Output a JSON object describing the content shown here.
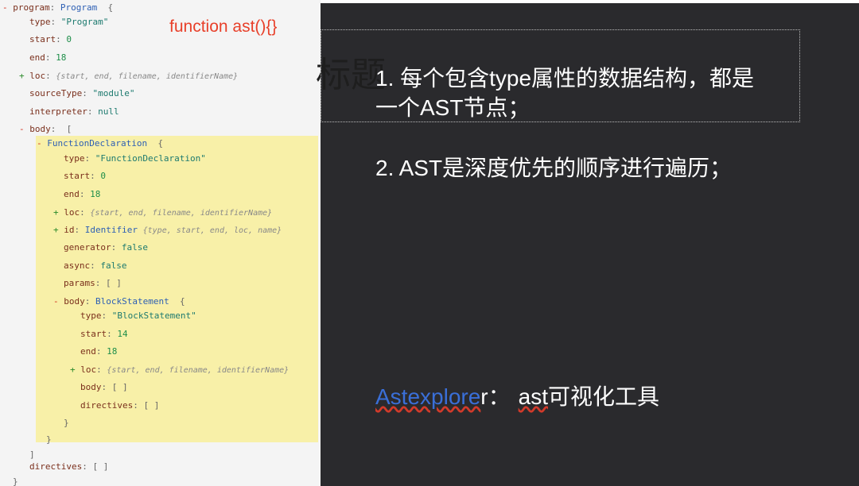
{
  "ast_tree": {
    "lines": [
      {
        "parts": [
          [
            "- ",
            "pm"
          ],
          [
            "program",
            "key"
          ],
          [
            ": ",
            "br"
          ],
          [
            "Program",
            "cname"
          ],
          [
            "  {",
            "br"
          ]
        ]
      },
      {
        "parts": [
          [
            "type",
            "key"
          ],
          [
            ": ",
            "br"
          ],
          [
            "\"Program\"",
            "str"
          ]
        ]
      },
      {
        "parts": [
          [
            "start",
            "key"
          ],
          [
            ": ",
            "br"
          ],
          [
            "0",
            "num"
          ]
        ]
      },
      {
        "parts": [
          [
            "end",
            "key"
          ],
          [
            ": ",
            "br"
          ],
          [
            "18",
            "num"
          ]
        ]
      },
      {
        "parts": [
          [
            "+ ",
            "pp"
          ],
          [
            "loc",
            "key"
          ],
          [
            ": ",
            "br"
          ],
          [
            "{start, end, filename, identifierName}",
            "ital"
          ]
        ]
      },
      {
        "parts": [
          [
            "sourceType",
            "key"
          ],
          [
            ": ",
            "br"
          ],
          [
            "\"module\"",
            "str"
          ]
        ]
      },
      {
        "parts": [
          [
            "interpreter",
            "key"
          ],
          [
            ": ",
            "br"
          ],
          [
            "null",
            "kw"
          ]
        ]
      },
      {
        "parts": [
          [
            "- ",
            "pm"
          ],
          [
            "body",
            "key"
          ],
          [
            ":  [",
            "br"
          ]
        ]
      },
      {
        "parts": [
          [
            "- ",
            "pm"
          ],
          [
            "FunctionDeclaration",
            "cname"
          ],
          [
            "  {",
            "br"
          ]
        ]
      },
      {
        "parts": [
          [
            "type",
            "key"
          ],
          [
            ": ",
            "br"
          ],
          [
            "\"FunctionDeclaration\"",
            "str"
          ]
        ]
      },
      {
        "parts": [
          [
            "start",
            "key"
          ],
          [
            ": ",
            "br"
          ],
          [
            "0",
            "num"
          ]
        ]
      },
      {
        "parts": [
          [
            "end",
            "key"
          ],
          [
            ": ",
            "br"
          ],
          [
            "18",
            "num"
          ]
        ]
      },
      {
        "parts": [
          [
            "+ ",
            "pp"
          ],
          [
            "loc",
            "key"
          ],
          [
            ": ",
            "br"
          ],
          [
            "{start, end, filename, identifierName}",
            "ital"
          ]
        ]
      },
      {
        "parts": [
          [
            "+ ",
            "pp"
          ],
          [
            "id",
            "key"
          ],
          [
            ": ",
            "br"
          ],
          [
            "Identifier",
            "cname"
          ],
          [
            " ",
            "br"
          ],
          [
            "{type, start, end, loc, name}",
            "ital"
          ]
        ]
      },
      {
        "parts": [
          [
            "generator",
            "key"
          ],
          [
            ": ",
            "br"
          ],
          [
            "false",
            "kw"
          ]
        ]
      },
      {
        "parts": [
          [
            "async",
            "key"
          ],
          [
            ": ",
            "br"
          ],
          [
            "false",
            "kw"
          ]
        ]
      },
      {
        "parts": [
          [
            "params",
            "key"
          ],
          [
            ": ",
            "br"
          ],
          [
            "[ ]",
            "br"
          ]
        ]
      },
      {
        "parts": [
          [
            "- ",
            "pm"
          ],
          [
            "body",
            "key"
          ],
          [
            ": ",
            "br"
          ],
          [
            "BlockStatement",
            "cname"
          ],
          [
            "  {",
            "br"
          ]
        ]
      },
      {
        "parts": [
          [
            "type",
            "key"
          ],
          [
            ": ",
            "br"
          ],
          [
            "\"BlockStatement\"",
            "str"
          ]
        ]
      },
      {
        "parts": [
          [
            "start",
            "key"
          ],
          [
            ": ",
            "br"
          ],
          [
            "14",
            "num"
          ]
        ]
      },
      {
        "parts": [
          [
            "end",
            "key"
          ],
          [
            ": ",
            "br"
          ],
          [
            "18",
            "num"
          ]
        ]
      },
      {
        "parts": [
          [
            "+ ",
            "pp"
          ],
          [
            "loc",
            "key"
          ],
          [
            ": ",
            "br"
          ],
          [
            "{start, end, filename, identifierName}",
            "ital"
          ]
        ]
      },
      {
        "parts": [
          [
            "body",
            "key"
          ],
          [
            ": ",
            "br"
          ],
          [
            "[ ]",
            "br"
          ]
        ]
      },
      {
        "parts": [
          [
            "directives",
            "key"
          ],
          [
            ": ",
            "br"
          ],
          [
            "[ ]",
            "br"
          ]
        ]
      },
      {
        "parts": [
          [
            "}",
            "br"
          ]
        ]
      },
      {
        "parts": [
          [
            "}",
            "br"
          ]
        ]
      },
      {
        "parts": [
          [
            "]",
            "br"
          ]
        ]
      },
      {
        "parts": [
          [
            "directives",
            "key"
          ],
          [
            ": ",
            "br"
          ],
          [
            "[ ]",
            "br"
          ]
        ]
      },
      {
        "parts": [
          [
            "}",
            "br"
          ]
        ]
      }
    ]
  },
  "annotation": {
    "code": "function ast(){}"
  },
  "slide": {
    "ghost_title": "标题",
    "point1_line1": "1. 每个包含type属性的数据结构，都是",
    "point1_line2": "一个AST节点；",
    "point2": "2. AST是深度优先的顺序进行遍历；",
    "tool": {
      "link_text": "Astexplore",
      "tail_r": "r",
      "sep": "：",
      "ast_word": "ast",
      "desc": "可视化工具"
    }
  },
  "colors": {
    "highlight": "#f8f0a8",
    "slide_bg": "#2a2a2d",
    "annotation": "#e8402a",
    "link": "#3a6fd8"
  }
}
